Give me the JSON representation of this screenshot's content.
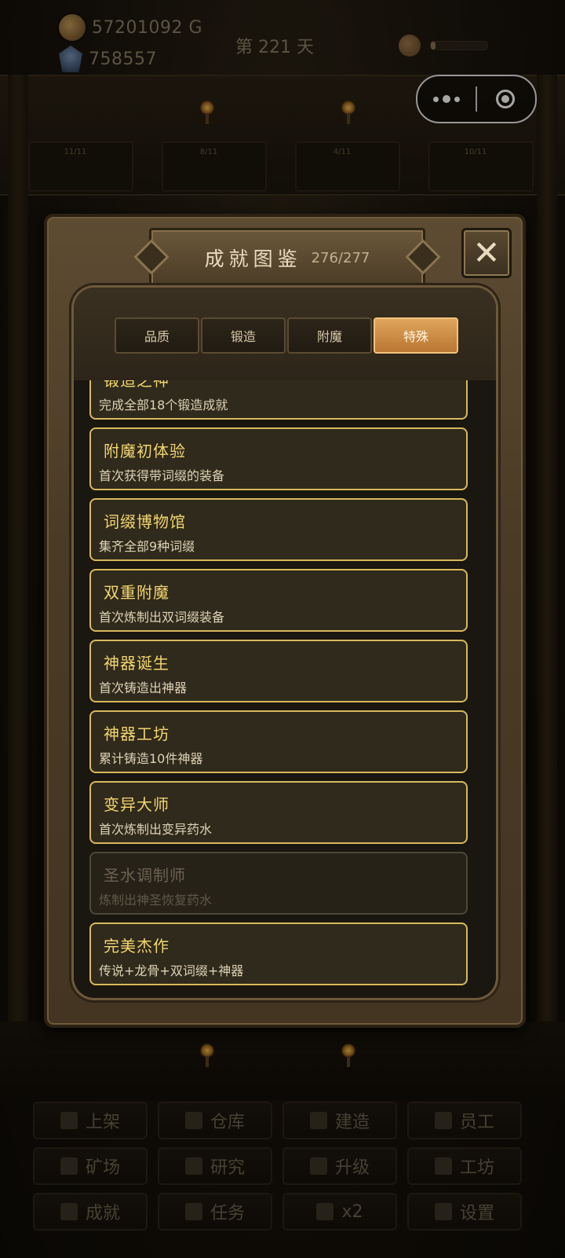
{
  "hud": {
    "gold": "57201092 G",
    "gems": "758557",
    "day": "第 221 天",
    "progress": 0.08
  },
  "shelves": [
    "11/11",
    "8/11",
    "4/11",
    "10/11"
  ],
  "modal": {
    "title": "成就图鉴",
    "count": "276/277",
    "close_label": "✕",
    "tabs": [
      {
        "label": "品质",
        "active": false
      },
      {
        "label": "锻造",
        "active": false
      },
      {
        "label": "附魔",
        "active": false
      },
      {
        "label": "特殊",
        "active": true
      }
    ],
    "achievements": [
      {
        "name": "锻造之神",
        "desc": "完成全部18个锻造成就",
        "unlocked": true
      },
      {
        "name": "附魔初体验",
        "desc": "首次获得带词缀的装备",
        "unlocked": true
      },
      {
        "name": "词缀博物馆",
        "desc": "集齐全部9种词缀",
        "unlocked": true
      },
      {
        "name": "双重附魔",
        "desc": "首次炼制出双词缀装备",
        "unlocked": true
      },
      {
        "name": "神器诞生",
        "desc": "首次铸造出神器",
        "unlocked": true
      },
      {
        "name": "神器工坊",
        "desc": "累计铸造10件神器",
        "unlocked": true
      },
      {
        "name": "变异大师",
        "desc": "首次炼制出变异药水",
        "unlocked": true
      },
      {
        "name": "圣水调制师",
        "desc": "炼制出神圣恢复药水",
        "unlocked": false
      },
      {
        "name": "完美杰作",
        "desc": "传说+龙骨+双词缀+神器",
        "unlocked": true
      }
    ]
  },
  "nav": [
    {
      "label": "上架",
      "icon": "hammer-icon"
    },
    {
      "label": "仓库",
      "icon": "crate-icon"
    },
    {
      "label": "建造",
      "icon": "building-icon"
    },
    {
      "label": "员工",
      "icon": "person-icon"
    },
    {
      "label": "矿场",
      "icon": "pickaxe-icon"
    },
    {
      "label": "研究",
      "icon": "book-icon"
    },
    {
      "label": "升级",
      "icon": "upgrade-arrows-icon"
    },
    {
      "label": "工坊",
      "icon": "cart-icon"
    },
    {
      "label": "成就",
      "icon": "trophy-icon"
    },
    {
      "label": "任务",
      "icon": "task-icon"
    },
    {
      "label": "x2",
      "icon": "lightning-icon"
    },
    {
      "label": "设置",
      "icon": "fast-forward-icon"
    }
  ]
}
